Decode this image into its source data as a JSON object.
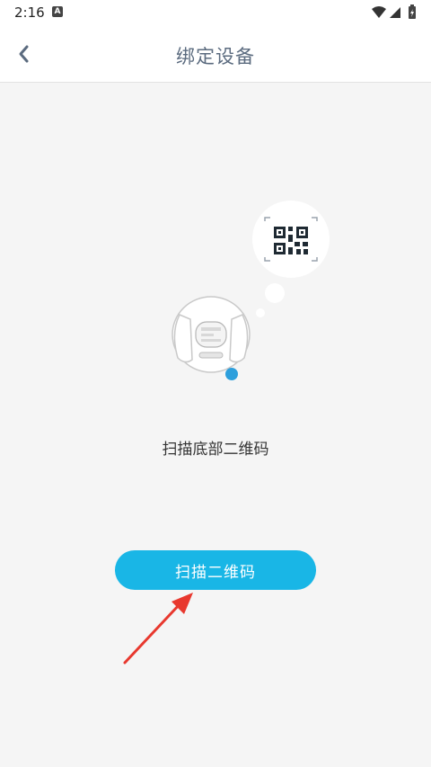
{
  "status_bar": {
    "time": "2:16",
    "notification_letter": "A"
  },
  "header": {
    "title": "绑定设备"
  },
  "main": {
    "instruction": "扫描底部二维码",
    "scan_button_label": "扫描二维码"
  },
  "colors": {
    "accent": "#19b6e6",
    "title": "#5b6b7f",
    "device_dot": "#2d9fdc",
    "arrow": "#e8382e"
  },
  "icons": [
    "back-chevron-icon",
    "qr-code-icon",
    "wifi-icon",
    "cell-signal-icon",
    "battery-charging-icon"
  ]
}
